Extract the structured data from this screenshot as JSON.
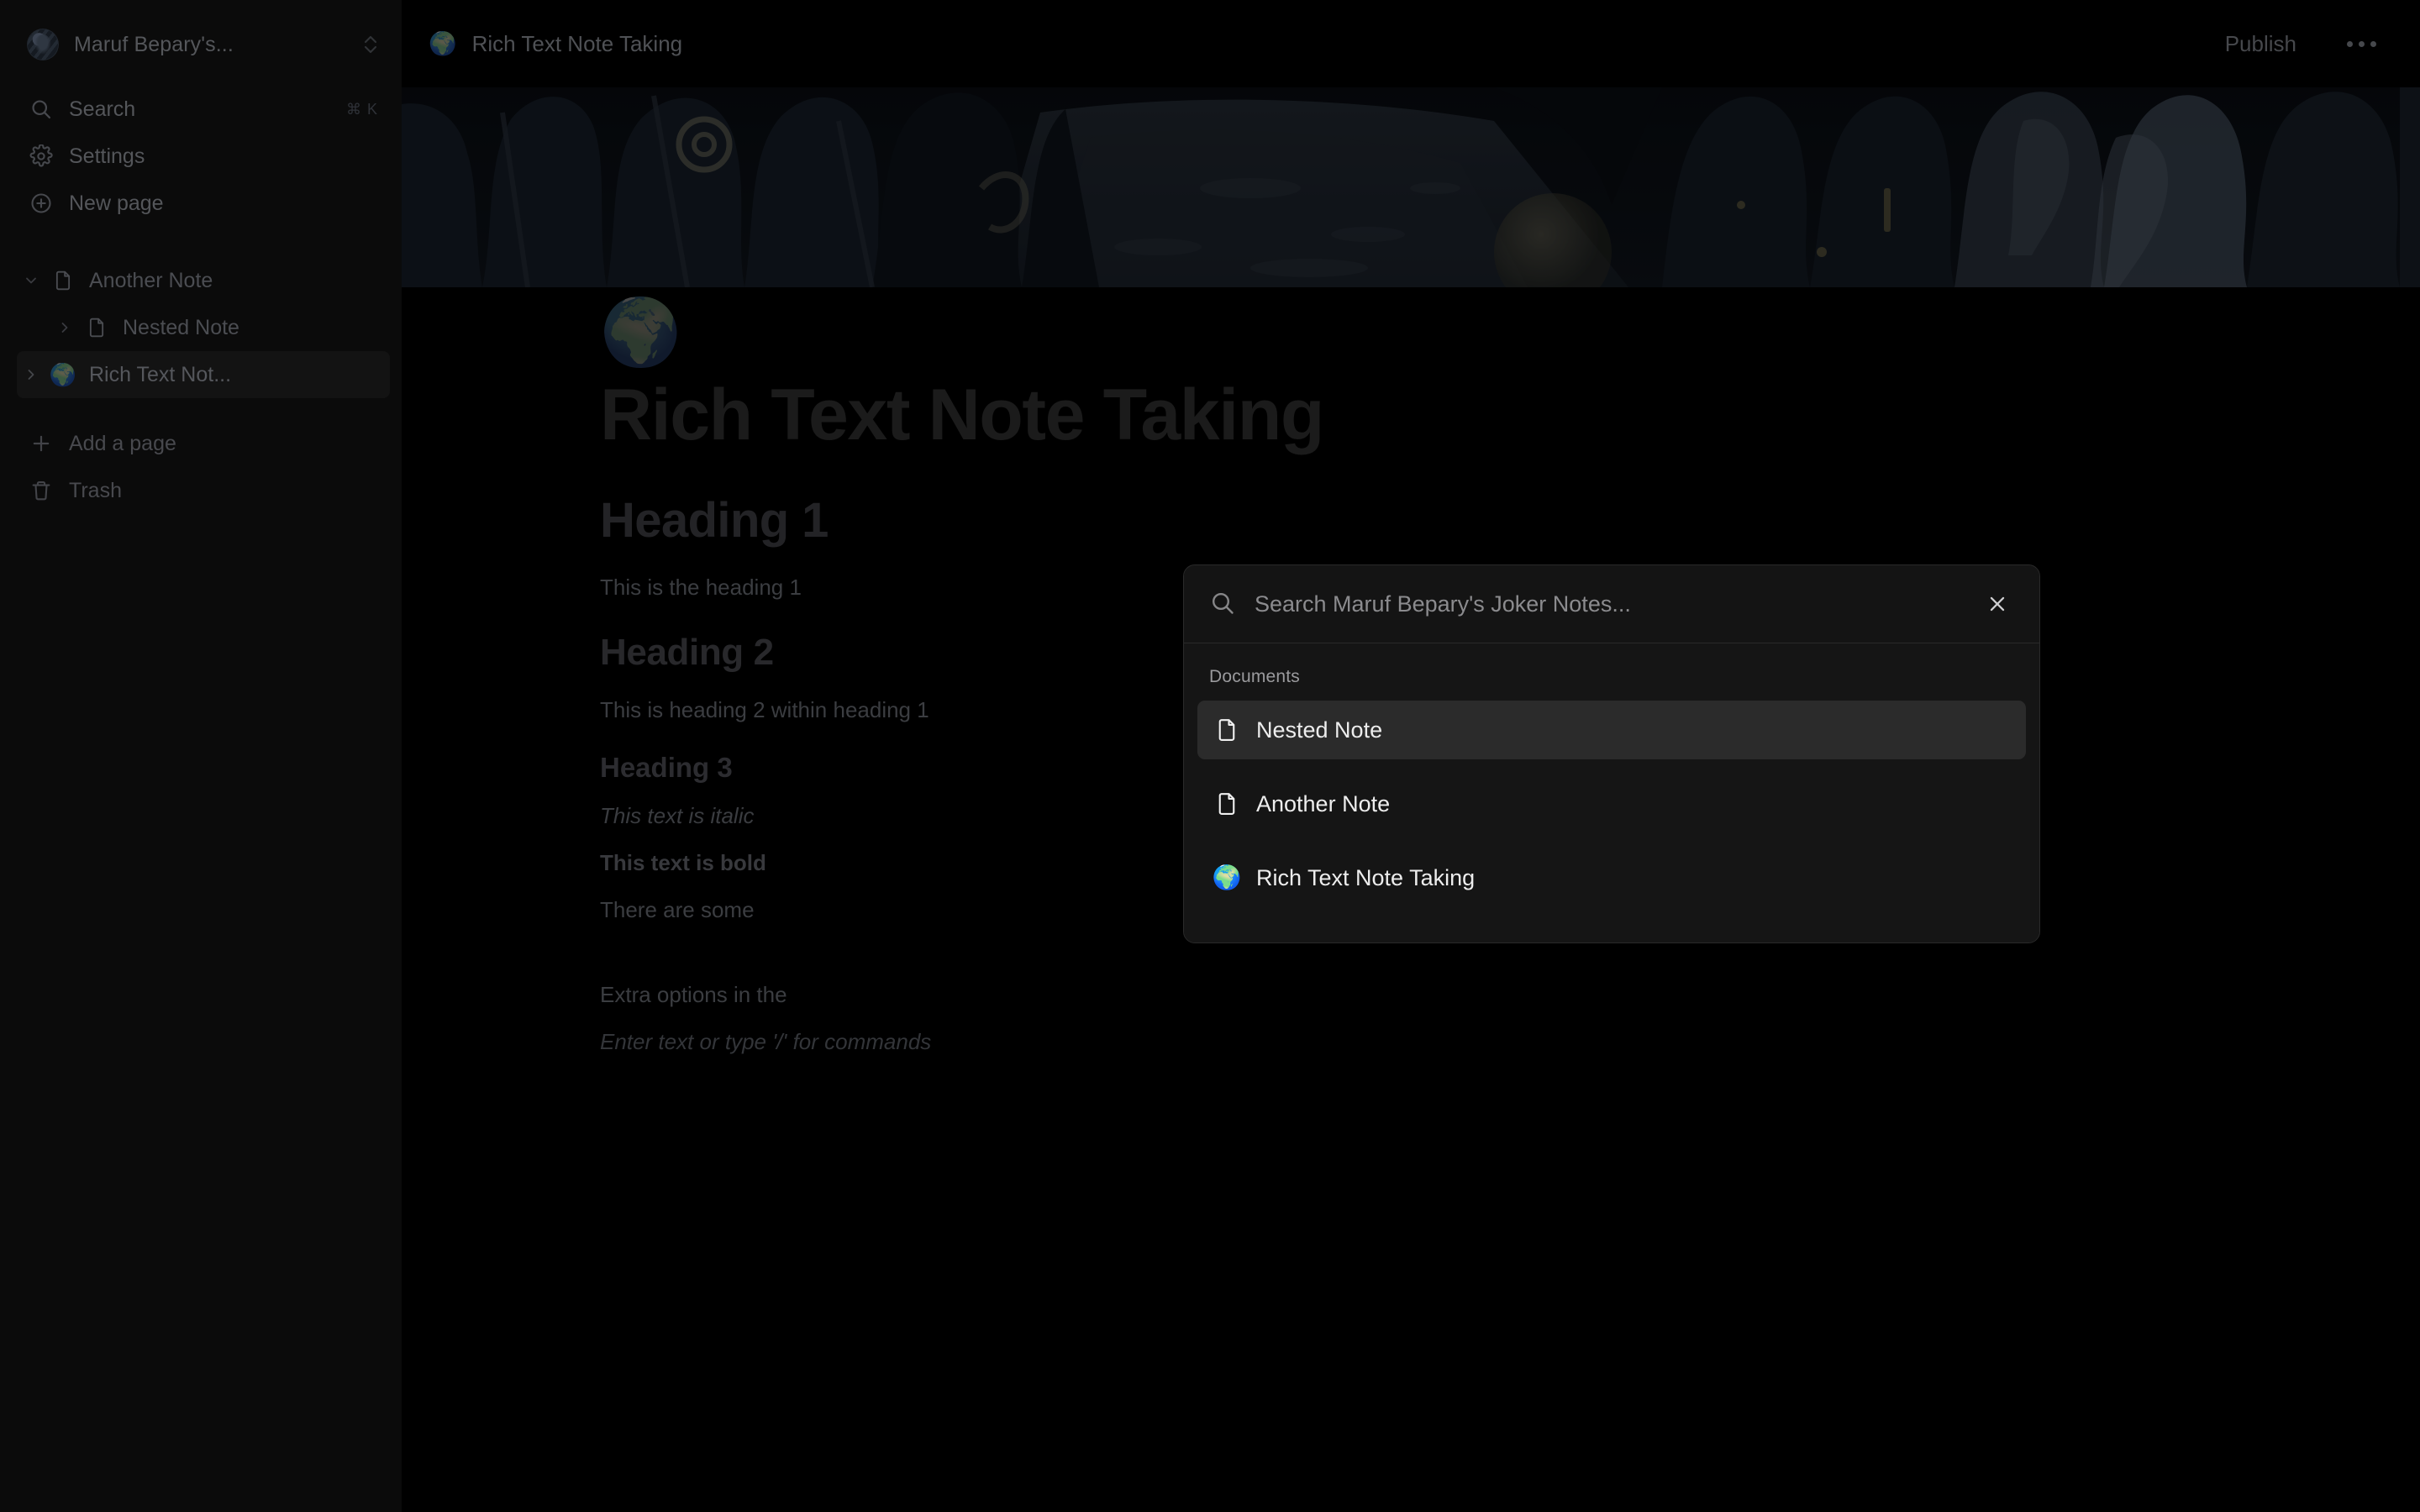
{
  "sidebar": {
    "workspace": {
      "name": "Maruf Bepary's...",
      "avatar_icon": "user-avatar",
      "switcher_icon": "chevron-up-down-icon"
    },
    "nav": [
      {
        "id": "search",
        "label": "Search",
        "icon": "search-icon",
        "shortcut": "⌘ K"
      },
      {
        "id": "settings",
        "label": "Settings",
        "icon": "gear-icon",
        "shortcut": ""
      },
      {
        "id": "new-page",
        "label": "New page",
        "icon": "plus-circle-icon",
        "shortcut": ""
      }
    ],
    "tree": [
      {
        "id": "another-note",
        "label": "Another Note",
        "icon": "file-icon",
        "disclosure": "chevron-down-icon",
        "depth": 0,
        "active": false
      },
      {
        "id": "nested-note",
        "label": "Nested Note",
        "icon": "file-icon",
        "disclosure": "chevron-right-icon",
        "depth": 1,
        "active": false
      },
      {
        "id": "rich-text-note",
        "label": "Rich Text Not...",
        "icon": "globe-emoji",
        "disclosure": "chevron-right-icon",
        "depth": 0,
        "active": true
      }
    ],
    "tail": [
      {
        "id": "add-a-page",
        "label": "Add a page",
        "icon": "plus-icon"
      },
      {
        "id": "trash",
        "label": "Trash",
        "icon": "trash-icon"
      }
    ]
  },
  "topbar": {
    "emoji": "🌍",
    "title": "Rich Text Note Taking",
    "publish_label": "Publish",
    "menu_icon": "more-horizontal-icon"
  },
  "document": {
    "emoji": "🌍",
    "title": "Rich Text Note Taking",
    "blocks": [
      {
        "type": "h1",
        "text": "Heading 1"
      },
      {
        "type": "p",
        "text": "This is the heading 1"
      },
      {
        "type": "h2",
        "text": "Heading 2"
      },
      {
        "type": "p",
        "text": "This is heading 2 within heading 1"
      },
      {
        "type": "h3",
        "text": "Heading 3"
      },
      {
        "type": "italic",
        "text": "This text is italic"
      },
      {
        "type": "bold",
        "text": "This text is bold"
      },
      {
        "type": "p",
        "text": "There are some"
      },
      {
        "type": "spacer",
        "text": ""
      },
      {
        "type": "p",
        "text": "Extra options in the"
      },
      {
        "type": "placeholder",
        "text": "Enter text or type '/' for commands"
      }
    ]
  },
  "search_modal": {
    "placeholder": "Search Maruf Bepary's Joker Notes...",
    "value": "",
    "search_icon": "search-icon",
    "close_icon": "close-icon",
    "section_label": "Documents",
    "results": [
      {
        "id": "nested-note",
        "label": "Nested Note",
        "icon": "file-icon",
        "selected": true
      },
      {
        "id": "another-note",
        "label": "Another Note",
        "icon": "file-icon",
        "selected": false
      },
      {
        "id": "rich-text-note-taking",
        "label": "Rich Text Note Taking",
        "icon": "globe-emoji",
        "selected": false
      }
    ]
  },
  "colors": {
    "app_background": "#000000",
    "sidebar_background": "#0b0b0b",
    "modal_background": "#151515",
    "modal_border": "#2a2a2a",
    "selected_row": "#2b2b2b",
    "muted_text": "#54565a",
    "primary_text": "#ededed"
  }
}
